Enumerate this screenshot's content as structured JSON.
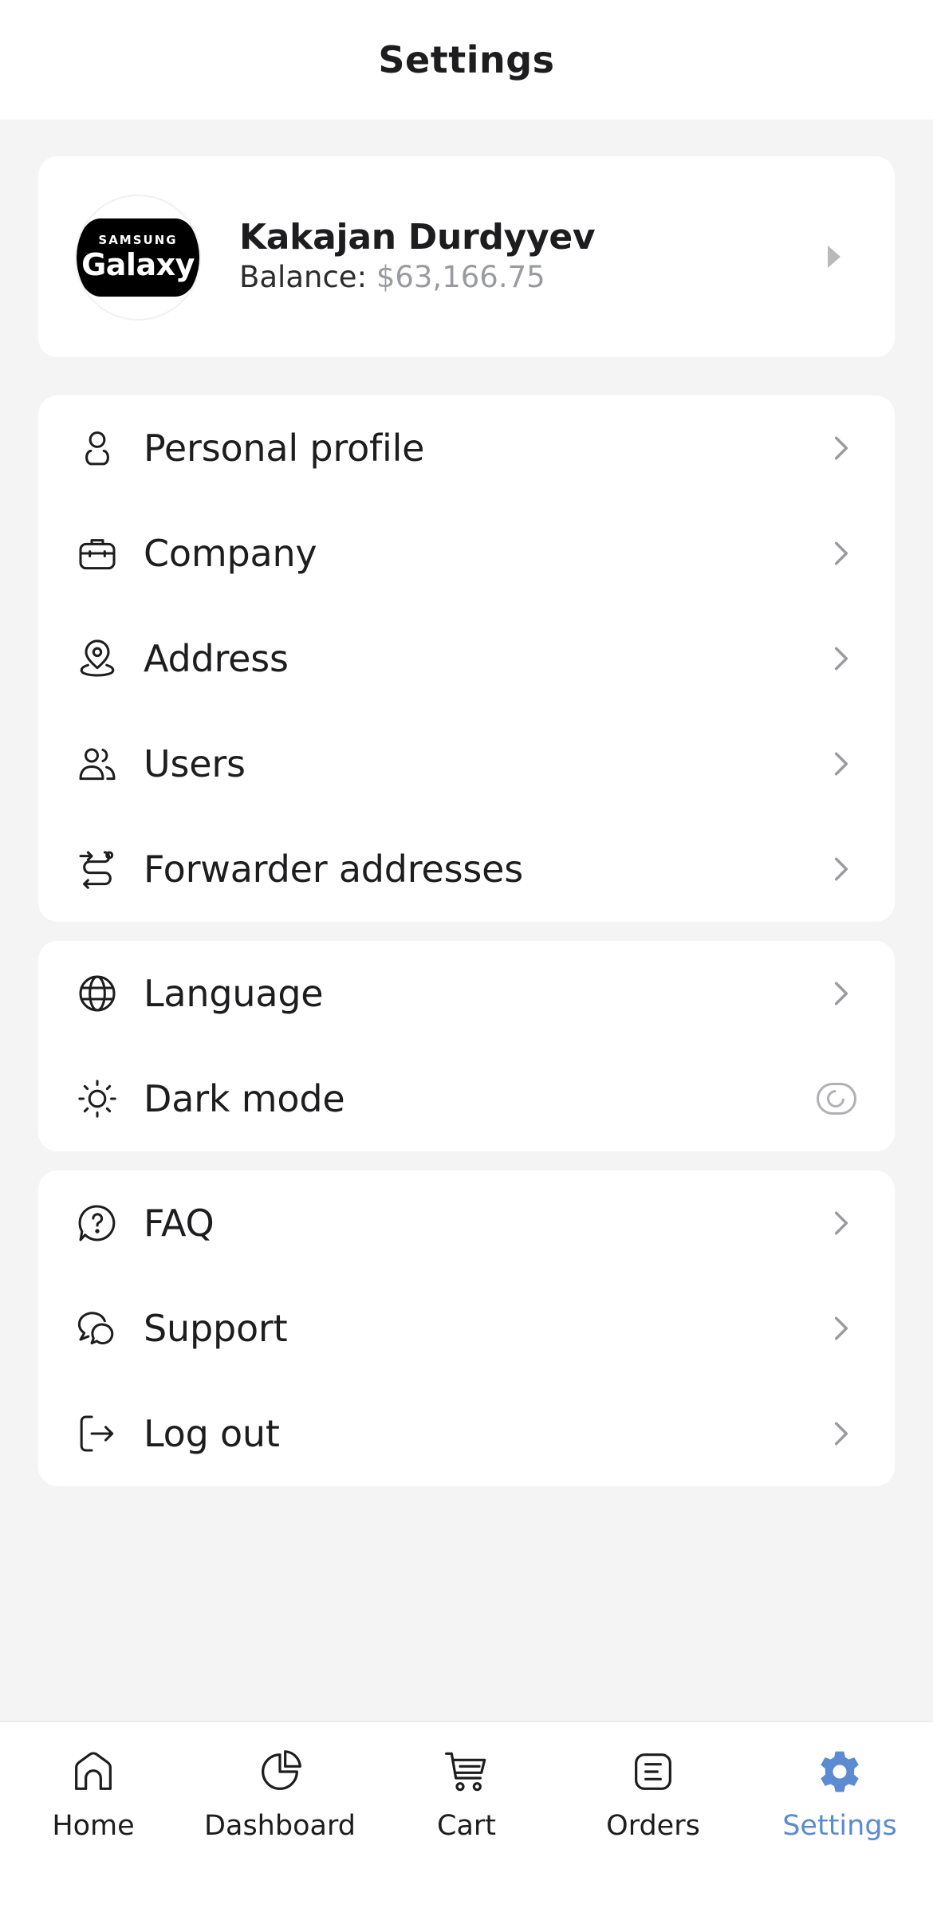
{
  "header": {
    "title": "Settings"
  },
  "profile": {
    "logo_top": "SAMSUNG",
    "logo_bottom": "Galaxy",
    "name": "Kakajan Durdyyev",
    "balance_label": "Balance:",
    "balance_value": "$63,166.75"
  },
  "menu_main": [
    {
      "label": "Personal profile",
      "icon": "user-icon"
    },
    {
      "label": "Company",
      "icon": "briefcase-icon"
    },
    {
      "label": "Address",
      "icon": "location-icon"
    },
    {
      "label": "Users",
      "icon": "users-icon"
    },
    {
      "label": "Forwarder addresses",
      "icon": "route-icon"
    }
  ],
  "menu_prefs": [
    {
      "label": "Language",
      "icon": "globe-icon"
    },
    {
      "label": "Dark mode",
      "icon": "sun-icon",
      "toggle": false
    }
  ],
  "menu_help": [
    {
      "label": "FAQ",
      "icon": "question-icon"
    },
    {
      "label": "Support",
      "icon": "chat-icon"
    },
    {
      "label": "Log out",
      "icon": "logout-icon"
    }
  ],
  "bottom_nav": [
    {
      "label": "Home",
      "icon": "home-icon"
    },
    {
      "label": "Dashboard",
      "icon": "pie-chart-icon"
    },
    {
      "label": "Cart",
      "icon": "cart-icon"
    },
    {
      "label": "Orders",
      "icon": "orders-icon"
    },
    {
      "label": "Settings",
      "icon": "gear-icon",
      "active": true
    }
  ],
  "colors": {
    "accent": "#5b8bd0",
    "background": "#f4f4f5",
    "card": "#ffffff",
    "muted": "#9a9ba0"
  }
}
